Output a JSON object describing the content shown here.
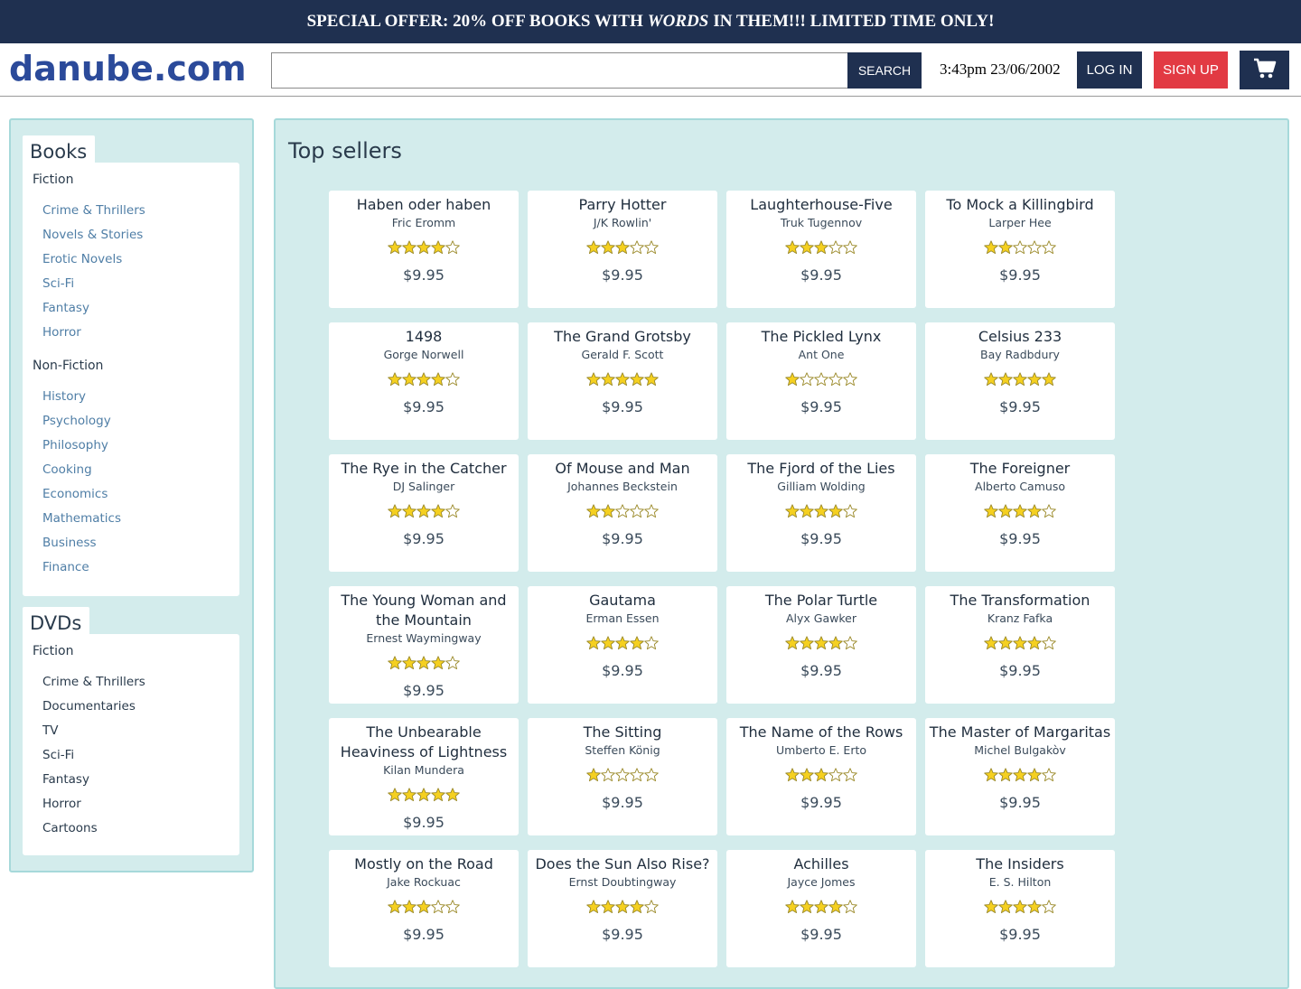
{
  "banner": {
    "pre": "SPECIAL OFFER: 20% OFF BOOKS WITH",
    "emphasis": "WORDS",
    "post": "IN THEM!!! LIMITED TIME ONLY!"
  },
  "header": {
    "logo": "danube.com",
    "search_button": "SEARCH",
    "search_value": "",
    "datetime": "3:43pm 23/06/2002",
    "login": "LOG IN",
    "signup": "SIGN UP",
    "cart_icon": "cart-icon"
  },
  "sidebar": {
    "books": {
      "title": "Books",
      "fiction_title": "Fiction",
      "fiction": [
        "Crime & Thrillers",
        "Novels & Stories",
        "Erotic Novels",
        "Sci-Fi",
        "Fantasy",
        "Horror"
      ],
      "nonfiction_title": "Non-Fiction",
      "nonfiction": [
        "History",
        "Psychology",
        "Philosophy",
        "Cooking",
        "Economics",
        "Mathematics",
        "Business",
        "Finance"
      ]
    },
    "dvds": {
      "title": "DVDs",
      "fiction_title": "Fiction",
      "fiction": [
        "Crime & Thrillers",
        "Documentaries",
        "TV",
        "Sci-Fi",
        "Fantasy",
        "Horror",
        "Cartoons"
      ]
    }
  },
  "main": {
    "title": "Top sellers",
    "star_color": "#f5d020",
    "products": [
      {
        "title": "Haben oder haben",
        "author": "Fric Eromm",
        "rating": 4,
        "price": "$9.95"
      },
      {
        "title": "Parry Hotter",
        "author": "J/K Rowlin'",
        "rating": 3,
        "price": "$9.95"
      },
      {
        "title": "Laughterhouse-Five",
        "author": "Truk Tugennov",
        "rating": 3,
        "price": "$9.95"
      },
      {
        "title": "To Mock a Killingbird",
        "author": "Larper Hee",
        "rating": 2,
        "price": "$9.95"
      },
      {
        "title": "1498",
        "author": "Gorge Norwell",
        "rating": 4,
        "price": "$9.95"
      },
      {
        "title": "The Grand Grotsby",
        "author": "Gerald F. Scott",
        "rating": 5,
        "price": "$9.95"
      },
      {
        "title": "The Pickled Lynx",
        "author": "Ant One",
        "rating": 1,
        "price": "$9.95"
      },
      {
        "title": "Celsius 233",
        "author": "Bay Radbdury",
        "rating": 5,
        "price": "$9.95"
      },
      {
        "title": "The Rye in the Catcher",
        "author": "DJ Salinger",
        "rating": 4,
        "price": "$9.95"
      },
      {
        "title": "Of Mouse and Man",
        "author": "Johannes Beckstein",
        "rating": 2,
        "price": "$9.95"
      },
      {
        "title": "The Fjord of the Lies",
        "author": "Gilliam Wolding",
        "rating": 4,
        "price": "$9.95"
      },
      {
        "title": "The Foreigner",
        "author": "Alberto Camuso",
        "rating": 4,
        "price": "$9.95"
      },
      {
        "title": "The Young Woman and the Mountain",
        "author": "Ernest Waymingway",
        "rating": 4,
        "price": "$9.95"
      },
      {
        "title": "Gautama",
        "author": "Erman Essen",
        "rating": 4,
        "price": "$9.95"
      },
      {
        "title": "The Polar Turtle",
        "author": "Alyx Gawker",
        "rating": 4,
        "price": "$9.95"
      },
      {
        "title": "The Transformation",
        "author": "Kranz Fafka",
        "rating": 4,
        "price": "$9.95"
      },
      {
        "title": "The Unbearable Heaviness of Lightness",
        "author": "Kilan Mundera",
        "rating": 5,
        "price": "$9.95"
      },
      {
        "title": "The Sitting",
        "author": "Steffen König",
        "rating": 1,
        "price": "$9.95"
      },
      {
        "title": "The Name of the Rows",
        "author": "Umberto E. Erto",
        "rating": 3,
        "price": "$9.95"
      },
      {
        "title": "The Master of Margaritas",
        "author": "Michel Bulgakòv",
        "rating": 4,
        "price": "$9.95"
      },
      {
        "title": "Mostly on the Road",
        "author": "Jake Rockuac",
        "rating": 3,
        "price": "$9.95"
      },
      {
        "title": "Does the Sun Also Rise?",
        "author": "Ernst Doubtingway",
        "rating": 4,
        "price": "$9.95"
      },
      {
        "title": "Achilles",
        "author": "Jayce Jomes",
        "rating": 4,
        "price": "$9.95"
      },
      {
        "title": "The Insiders",
        "author": "E. S. Hilton",
        "rating": 4,
        "price": "$9.95"
      }
    ]
  }
}
